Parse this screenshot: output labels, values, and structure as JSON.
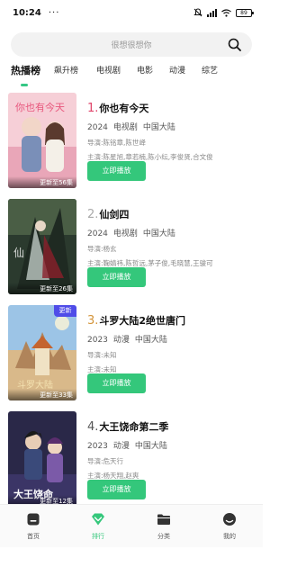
{
  "status_bar": {
    "time": "10:24",
    "dots": "···",
    "battery": "89"
  },
  "search": {
    "placeholder": "很想很想你"
  },
  "tabs": [
    {
      "label": "热播榜",
      "active": true
    },
    {
      "label": "飙升榜"
    },
    {
      "label": "电视剧"
    },
    {
      "label": "电影"
    },
    {
      "label": "动漫"
    },
    {
      "label": "综艺"
    }
  ],
  "items": [
    {
      "rank": "1.",
      "rank_color": "#e0446a",
      "title": "你也有今天",
      "year": "2024",
      "category": "电视剧",
      "region": "中国大陆",
      "director_label": "导演:",
      "director": "陈铭章,陈世峄",
      "cast_label": "主演:",
      "cast": "陈星旭,章若楠,陈小纭,李俊贤,合文俊",
      "update": "更新至56集",
      "button": "立即播放"
    },
    {
      "rank": "2.",
      "rank_color": "#aaaaaa",
      "title": "仙剑四",
      "year": "2024",
      "category": "电视剧",
      "region": "中国大陆",
      "director_label": "导演:",
      "director": "杨玄",
      "cast_label": "主演:",
      "cast": "鞠婧祎,陈哲远,茅子俊,毛晓慧,王骏可",
      "update": "更新至26集",
      "button": "立即播放"
    },
    {
      "rank": "3.",
      "rank_color": "#d4943a",
      "title": "斗罗大陆2绝世唐门",
      "year": "2023",
      "category": "动漫",
      "region": "中国大陆",
      "director_label": "导演:",
      "director": "未知",
      "cast_label": "主演:",
      "cast": "未知",
      "update": "更新至33集",
      "new_tag": "更新",
      "button": "立即播放"
    },
    {
      "rank": "4.",
      "rank_color": "#555555",
      "title": "大王饶命第二季",
      "year": "2023",
      "category": "动漫",
      "region": "中国大陆",
      "director_label": "导演:",
      "director": "危天行",
      "cast_label": "主演:",
      "cast": "杨天翔,赵爽",
      "update": "更新至12集",
      "button": "立即播放"
    }
  ],
  "bottom_nav": [
    {
      "label": "首页",
      "icon": "home-icon"
    },
    {
      "label": "排行",
      "icon": "ranking-icon",
      "active": true
    },
    {
      "label": "分类",
      "icon": "folder-icon"
    },
    {
      "label": "我的",
      "icon": "profile-icon"
    }
  ],
  "colors": {
    "accent": "#34c77b",
    "new_tag": "#4f4ce8"
  }
}
